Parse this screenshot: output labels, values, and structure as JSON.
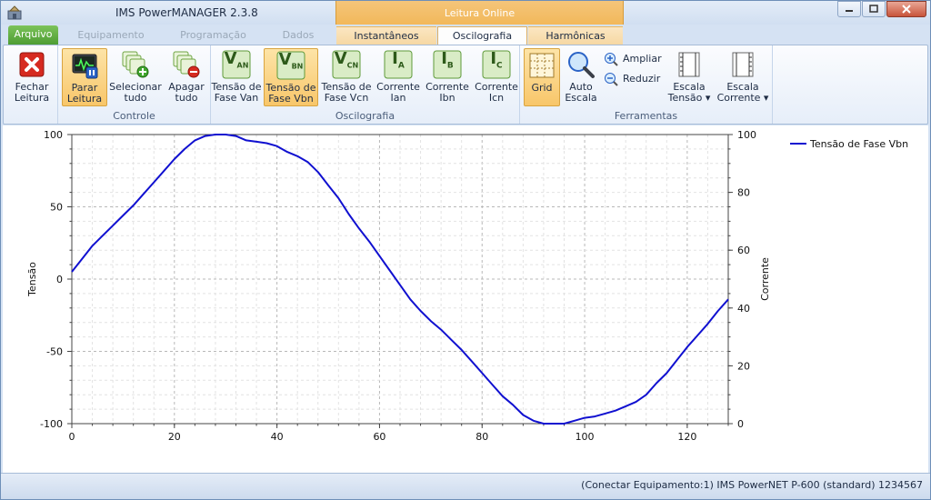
{
  "window": {
    "title": "IMS PowerMANAGER 2.3.8",
    "context_header": "Leitura Online"
  },
  "tabs": {
    "arquivo": "Arquivo",
    "equipamento": "Equipamento",
    "programacao": "Programação",
    "dados": "Dados",
    "instantaneos": "Instantâneos",
    "oscilografia": "Oscilografia",
    "harmonicas": "Harmônicas"
  },
  "ribbon": {
    "fechar": {
      "line1": "Fechar",
      "line2": "Leitura"
    },
    "controle": {
      "label": "Controle",
      "parar": {
        "line1": "Parar",
        "line2": "Leitura"
      },
      "selecionar": {
        "line1": "Selecionar",
        "line2": "tudo"
      },
      "apagar": {
        "line1": "Apagar",
        "line2": "tudo"
      }
    },
    "oscilografia": {
      "label": "Oscilografia",
      "van": {
        "line1": "Tensão de",
        "line2": "Fase Van",
        "icon_main": "V",
        "icon_sub": "AN"
      },
      "vbn": {
        "line1": "Tensão de",
        "line2": "Fase Vbn",
        "icon_main": "V",
        "icon_sub": "BN"
      },
      "vcn": {
        "line1": "Tensão de",
        "line2": "Fase Vcn",
        "icon_main": "V",
        "icon_sub": "CN"
      },
      "ian": {
        "line1": "Corrente",
        "line2": "Ian",
        "icon_main": "I",
        "icon_sub": "A"
      },
      "ibn": {
        "line1": "Corrente",
        "line2": "Ibn",
        "icon_main": "I",
        "icon_sub": "B"
      },
      "icn": {
        "line1": "Corrente",
        "line2": "Icn",
        "icon_main": "I",
        "icon_sub": "C"
      }
    },
    "ferramentas": {
      "label": "Ferramentas",
      "grid": "Grid",
      "auto": {
        "line1": "Auto",
        "line2": "Escala"
      },
      "ampliar": "Ampliar",
      "reduzir": "Reduzir",
      "escala_tensao": {
        "line1": "Escala",
        "line2": "Tensão ▾"
      },
      "escala_corrente": {
        "line1": "Escala",
        "line2": "Corrente ▾"
      }
    }
  },
  "status": {
    "text": "(Conectar Equipamento:1) IMS PowerNET P-600 (standard) 1234567"
  },
  "colors": {
    "series": "#1010d0",
    "selected_button": "#f8c66a",
    "file_tab": "#4e9d33",
    "context_tab": "#f2b85a"
  },
  "chart_data": {
    "type": "line",
    "xlabel": "",
    "ylabel_left": "Tensão",
    "ylabel_right": "Corrente",
    "xlim": [
      0,
      128
    ],
    "ylim_left": [
      -100,
      100
    ],
    "ylim_right": [
      0,
      100
    ],
    "x_ticks": [
      0,
      20,
      40,
      60,
      80,
      100,
      120
    ],
    "y_ticks_left": [
      -100,
      -50,
      0,
      50,
      100
    ],
    "y_ticks_right": [
      0,
      20,
      40,
      60,
      80,
      100
    ],
    "grid": true,
    "legend_position": "top-right",
    "series": [
      {
        "name": "Tensão de Fase Vbn",
        "axis": "left",
        "x": [
          0,
          2,
          4,
          6,
          8,
          10,
          12,
          14,
          16,
          18,
          20,
          22,
          24,
          26,
          28,
          30,
          32,
          34,
          36,
          38,
          40,
          42,
          44,
          46,
          48,
          50,
          52,
          54,
          56,
          58,
          60,
          62,
          64,
          66,
          68,
          70,
          72,
          74,
          76,
          78,
          80,
          82,
          84,
          86,
          88,
          90,
          92,
          94,
          96,
          98,
          100,
          102,
          104,
          106,
          108,
          110,
          112,
          114,
          116,
          118,
          120,
          122,
          124,
          126,
          128
        ],
        "y": [
          5,
          14,
          23,
          30,
          37,
          44,
          51,
          59,
          67,
          75,
          83,
          90,
          96,
          99,
          100,
          100,
          99,
          96,
          95,
          94,
          92,
          88,
          85,
          81,
          74,
          65,
          56,
          45,
          35,
          26,
          16,
          6,
          -4,
          -14,
          -22,
          -29,
          -35,
          -42,
          -49,
          -57,
          -65,
          -73,
          -81,
          -87,
          -94,
          -98,
          -100,
          -100,
          -100,
          -98,
          -96,
          -95,
          -93,
          -91,
          -88,
          -85,
          -80,
          -72,
          -65,
          -56,
          -47,
          -39,
          -31,
          -22,
          -14
        ]
      }
    ]
  }
}
